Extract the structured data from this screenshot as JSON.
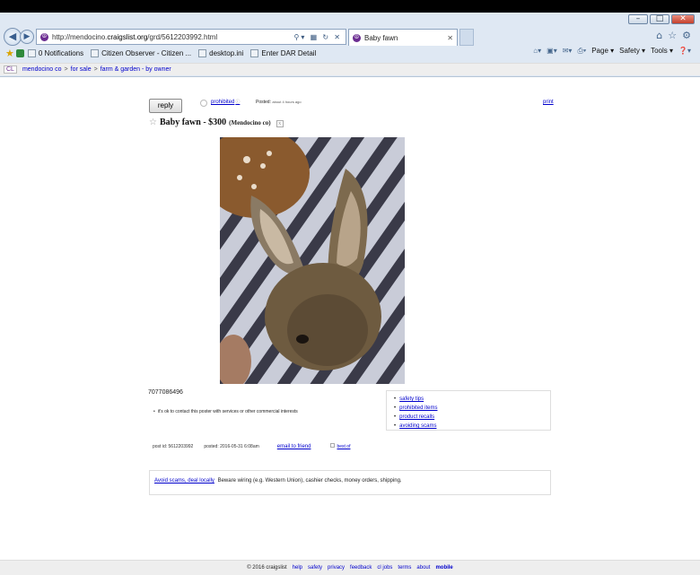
{
  "browser": {
    "url_prefix": "http://mendocino.",
    "url_host": "craigslist.org",
    "url_path": "/grd/5612203992.html",
    "tab_title": "Baby fawn",
    "favorites": [
      {
        "label": "0 Notifications",
        "icon": "notification-icon"
      },
      {
        "label": "Citizen Observer - Citizen ...",
        "icon": "page-icon"
      },
      {
        "label": "desktop.ini",
        "icon": "file-icon"
      },
      {
        "label": "Enter DAR Detail",
        "icon": "dar-icon"
      }
    ],
    "command_bar": [
      "Page",
      "Safety",
      "Tools"
    ]
  },
  "breadcrumb": {
    "logo": "CL",
    "items": [
      "mendocino co",
      "for sale",
      "farm & garden - by owner"
    ]
  },
  "posting": {
    "reply_label": "reply",
    "prohibited_label": "prohibited",
    "posted_label": "Posted:",
    "posted_ago": "about 4 hours ago",
    "print_label": "print",
    "title": "Baby fawn - $300",
    "location": "(Mendocino co)",
    "hide_label": "x",
    "phone": "7077086496",
    "contact_notice": "it's ok to contact this poster with services or other commercial interests",
    "post_id": "post id: 5612203992",
    "posted_date": "posted: 2016-05-31 6:08am",
    "email_label": "email to friend",
    "best_of_label": "best of"
  },
  "safety_links": [
    "safety tips",
    "prohibited items",
    "product recalls",
    "avoiding scams"
  ],
  "scam_notice": {
    "link": "Avoid scams, deal locally",
    "text": "Beware wiring (e.g. Western Union), cashier checks, money orders, shipping."
  },
  "footer": {
    "copyright": "© 2016 craigslist",
    "links": [
      "help",
      "safety",
      "privacy",
      "feedback",
      "cl jobs",
      "terms",
      "about"
    ],
    "mobile": "mobile"
  }
}
